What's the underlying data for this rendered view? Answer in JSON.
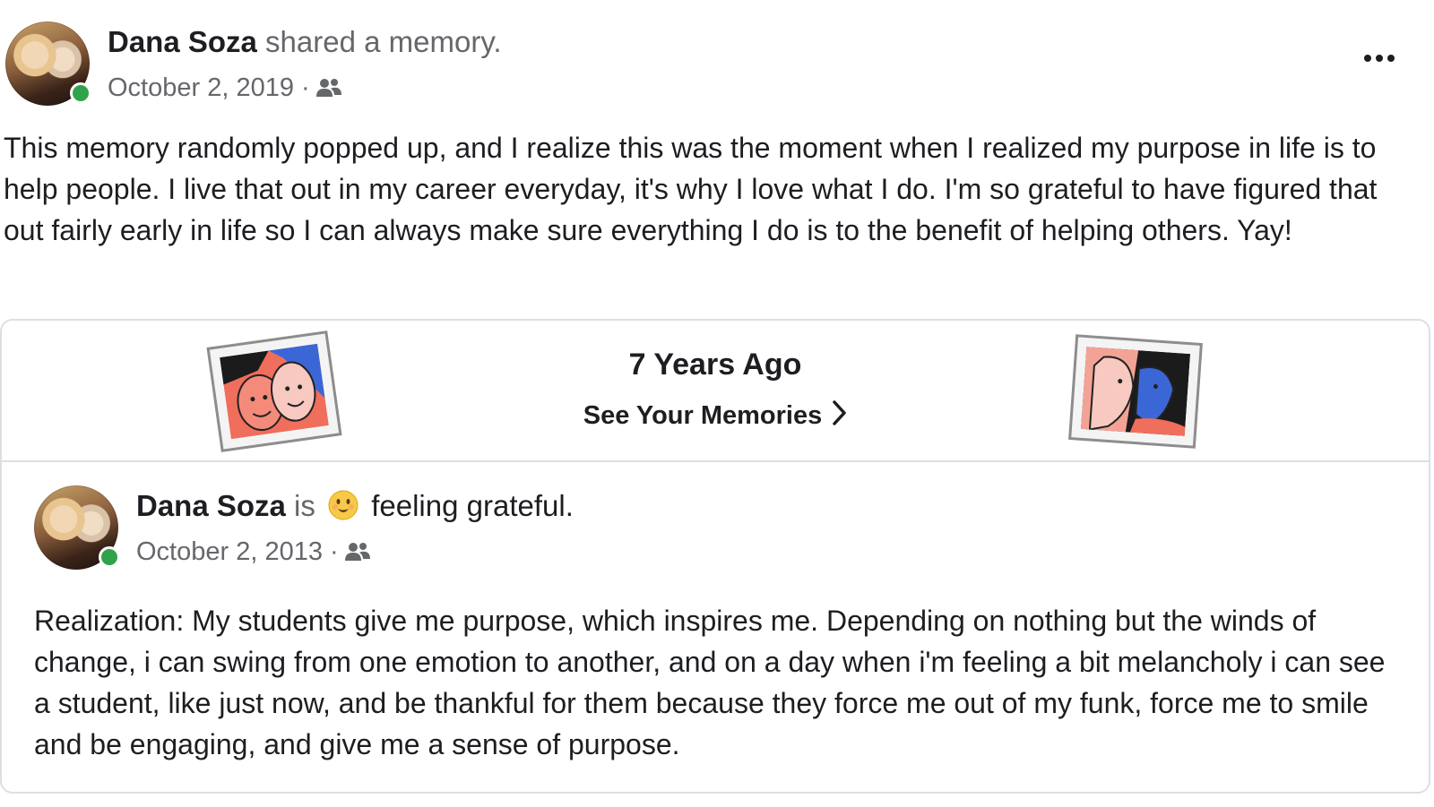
{
  "post": {
    "author": "Dana Soza",
    "action": " shared a memory.",
    "date": "October 2, 2019 ·",
    "audience_icon": "friends-icon",
    "more_icon": "more-options-icon",
    "text": "This memory randomly popped up, and I realize this was the moment when I realized my purpose in life is to help people. I live that out in my career everyday, it's why I love what I do. I'm so grateful to have figured that out fairly early in life so I can always make sure everything I do is to the benefit of helping others. Yay!"
  },
  "memory_banner": {
    "title": "7 Years Ago",
    "link": "See Your Memories",
    "link_icon": "chevron-right-icon"
  },
  "original_post": {
    "author": "Dana Soza",
    "is_word": " is ",
    "feeling_emoji": "smiling-emoji-icon",
    "feeling": " feeling grateful.",
    "date": "October 2, 2013 ·",
    "audience_icon": "friends-icon",
    "text": "Realization: My students give me purpose, which inspires me. Depending on nothing but the winds of change, i can swing from one emotion to another, and on a day when i'm feeling a bit melancholy i can see a student, like just now, and be thankful for them because they force me out of my funk, force me to smile and be engaging, and give me a sense of purpose."
  },
  "colors": {
    "online": "#31a24c",
    "text_primary": "#1c1e21",
    "text_secondary": "#65676b",
    "border": "#dddfe2"
  }
}
